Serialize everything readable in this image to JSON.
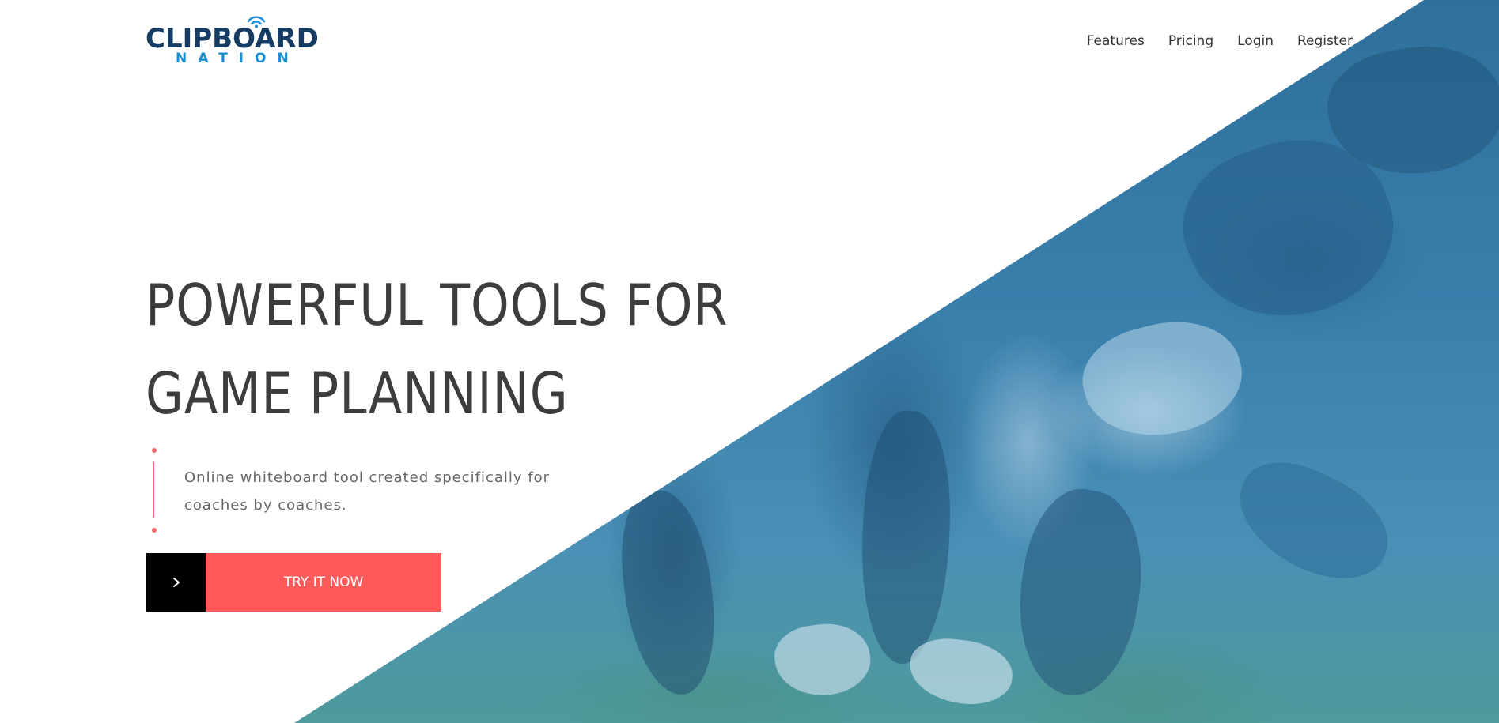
{
  "brand": {
    "name_top": "CLIPBOARD",
    "name_bottom": "NATION",
    "colors": {
      "dark_blue": "#163c64",
      "light_blue": "#1b8fd0"
    }
  },
  "nav": {
    "items": [
      {
        "label": "Features"
      },
      {
        "label": "Pricing"
      },
      {
        "label": "Login"
      },
      {
        "label": "Register"
      }
    ]
  },
  "hero": {
    "title": "POWERFUL TOOLS FOR GAME PLANNING",
    "description": "Online whiteboard tool created specifically for coaches by coaches.",
    "cta": {
      "label": "TRY IT NOW",
      "icon": "chevron-right-icon"
    },
    "accent_color": "#ff5a5a",
    "photo_tint": "#3a80ad"
  }
}
